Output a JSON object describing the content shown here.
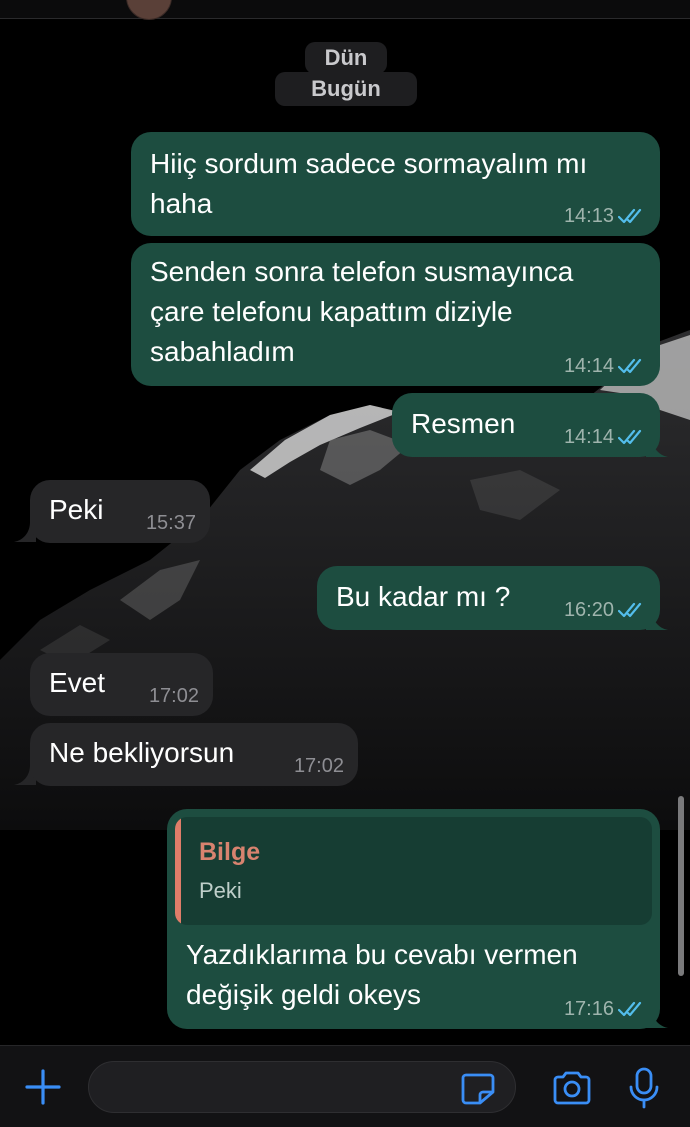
{
  "date_separators": {
    "yesterday": "Dün",
    "today": "Bugün"
  },
  "messages": [
    {
      "direction": "outgoing",
      "lines": [
        "Hiiç sordum sadece sormayalım mı",
        "haha"
      ],
      "time": "14:13",
      "status": "read"
    },
    {
      "direction": "outgoing",
      "lines": [
        "Senden sonra telefon susmayınca",
        "çare telefonu kapattım diziyle",
        "sabahladım"
      ],
      "time": "14:14",
      "status": "read"
    },
    {
      "direction": "outgoing",
      "lines": [
        "Resmen"
      ],
      "time": "14:14",
      "status": "read"
    },
    {
      "direction": "incoming",
      "lines": [
        "Peki"
      ],
      "time": "15:37"
    },
    {
      "direction": "outgoing",
      "lines": [
        "Bu kadar mı ?"
      ],
      "time": "16:20",
      "status": "read"
    },
    {
      "direction": "incoming",
      "lines": [
        "Evet"
      ],
      "time": "17:02"
    },
    {
      "direction": "incoming",
      "lines": [
        "Ne bekliyorsun"
      ],
      "time": "17:02"
    },
    {
      "direction": "outgoing",
      "reply_to": {
        "sender": "Bilge",
        "text": "Peki"
      },
      "lines": [
        "Yazdıklarıma bu cevabı vermen",
        "değişik geldi okeys"
      ],
      "time": "17:16",
      "status": "read"
    }
  ],
  "composer": {
    "input_value": "",
    "icons": [
      "plus-icon",
      "sticker-icon",
      "camera-icon",
      "microphone-icon"
    ]
  },
  "colors": {
    "outgoing_bubble": "#1d4d40",
    "incoming_bubble": "#262628",
    "read_ticks": "#53bdeb",
    "quote_accent": "#e07d69",
    "accent_blue": "#3a8ef6"
  }
}
